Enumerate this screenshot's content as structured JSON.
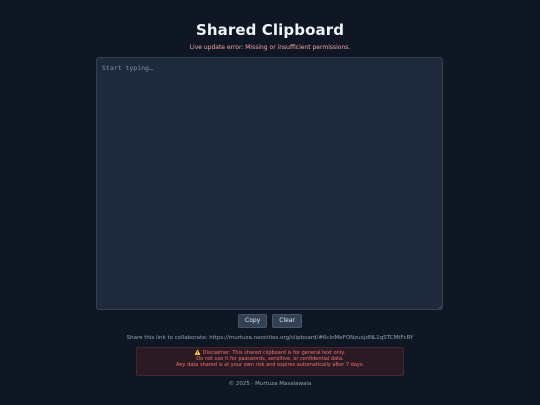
{
  "header": {
    "title": "Shared Clipboard",
    "error": "Live update error: Missing or insufficient permissions."
  },
  "editor": {
    "placeholder": "Start typing…",
    "value": ""
  },
  "buttons": {
    "copy": "Copy",
    "clear": "Clear"
  },
  "share": {
    "prefix": "Share this link to collaborate:",
    "link": "https://murtuza.neocities.org/clipboard/#6cInMeFONzuxjdNL1qSTCMtFcRY"
  },
  "disclaimer": {
    "icon": "warning-icon",
    "line1": "Disclaimer: This shared clipboard is for general text only.",
    "line2": "Do not use it for passwords, sensitive, or confidential data.",
    "line3": "Any data shared is at your own risk and expires automatically after 7 days."
  },
  "footer": {
    "copyright": "© 2025",
    "separator": "·",
    "author": "Murtuza Masalawala"
  },
  "colors": {
    "background": "#0f1724",
    "panel": "#1e293b",
    "error": "#fca5a5",
    "disclaimer_text": "#f87171"
  }
}
